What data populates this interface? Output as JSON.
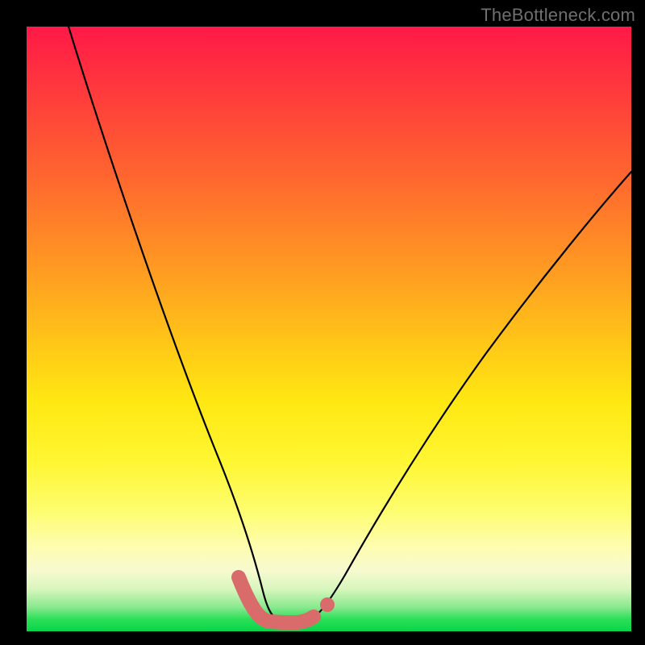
{
  "watermark": "TheBottleneck.com",
  "chart_data": {
    "type": "line",
    "title": "",
    "xlabel": "",
    "ylabel": "",
    "xlim": [
      0,
      100
    ],
    "ylim": [
      0,
      100
    ],
    "grid": false,
    "legend": false,
    "series": [
      {
        "name": "left-curve",
        "x": [
          7,
          10,
          14,
          18,
          22,
          26,
          29,
          32,
          34,
          36,
          37.5,
          38.5
        ],
        "y": [
          100,
          88,
          73,
          59,
          45,
          32,
          22,
          14,
          8.5,
          4.5,
          2.6,
          1.9
        ]
      },
      {
        "name": "bottom-flat",
        "x": [
          38.5,
          40,
          42,
          44,
          45.5,
          47
        ],
        "y": [
          1.9,
          1.5,
          1.4,
          1.5,
          1.8,
          2.3
        ]
      },
      {
        "name": "right-curve",
        "x": [
          47,
          50,
          54,
          60,
          66,
          74,
          82,
          90,
          98,
          100
        ],
        "y": [
          2.3,
          4.2,
          8,
          15,
          23,
          34,
          45,
          55,
          65,
          68
        ]
      }
    ],
    "markers": [
      {
        "name": "left-thick-descender",
        "x_range": [
          34.5,
          38.5
        ],
        "style": "thick-salmon"
      },
      {
        "name": "bottom-thick-flat",
        "x_range": [
          38.5,
          47
        ],
        "style": "thick-salmon"
      },
      {
        "name": "right-dot",
        "x": 49.3,
        "y": 3.6,
        "style": "salmon-dot"
      }
    ],
    "gradient_stops": [
      {
        "pos": 0.0,
        "color": "#ff1947"
      },
      {
        "pos": 0.5,
        "color": "#ffc518"
      },
      {
        "pos": 0.8,
        "color": "#fdfd6e"
      },
      {
        "pos": 1.0,
        "color": "#09d54a"
      }
    ]
  }
}
